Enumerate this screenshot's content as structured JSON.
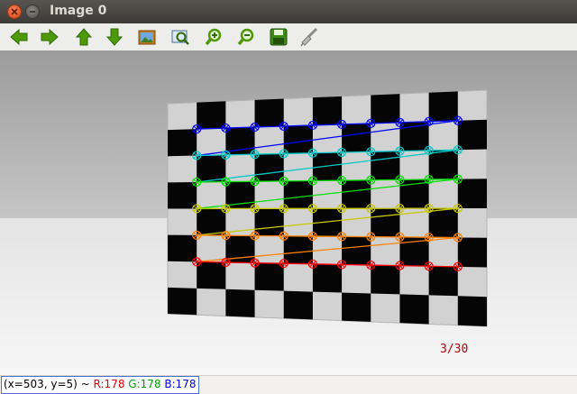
{
  "window": {
    "title": "Image 0"
  },
  "toolbar": {
    "buttons": [
      {
        "name": "back-button",
        "icon": "arrow-left-icon"
      },
      {
        "name": "forward-button",
        "icon": "arrow-right-icon"
      },
      {
        "name": "up-button",
        "icon": "arrow-up-icon"
      },
      {
        "name": "down-button",
        "icon": "arrow-down-icon"
      },
      {
        "name": "fit-image-button",
        "icon": "image-icon"
      },
      {
        "name": "zoom-region-button",
        "icon": "zoom-region-icon"
      },
      {
        "name": "zoom-in-button",
        "icon": "zoom-in-icon"
      },
      {
        "name": "zoom-out-button",
        "icon": "zoom-out-icon"
      },
      {
        "name": "save-button",
        "icon": "floppy-icon"
      },
      {
        "name": "properties-button",
        "icon": "brush-icon"
      }
    ]
  },
  "image": {
    "frame_counter": "3/30"
  },
  "status": {
    "coords": "(x=503, y=5) ~",
    "r": "R:178",
    "g": "G:178",
    "b": "B:178",
    "r_color": "#e00000",
    "g_color": "#00a000",
    "b_color": "#0000e0"
  },
  "colors": {
    "corner_rows": [
      "#0000ff",
      "#00c8c8",
      "#00e000",
      "#c8c800",
      "#ff8000",
      "#ff0000"
    ]
  }
}
